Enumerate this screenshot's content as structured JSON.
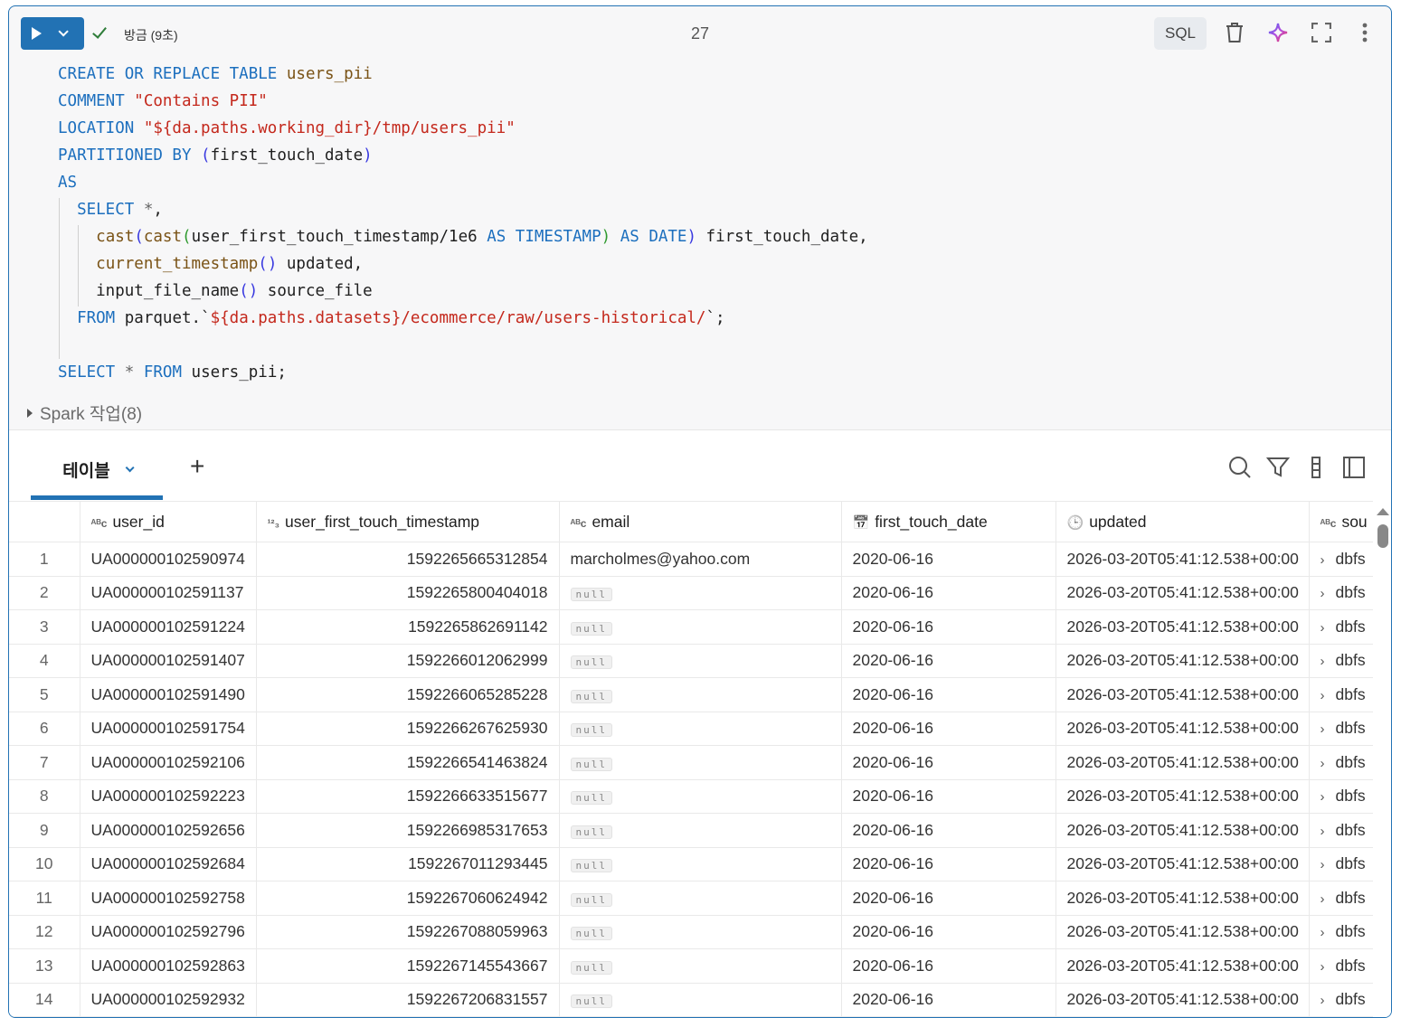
{
  "cell": {
    "status": "방금 (9초)",
    "cell_number": "27",
    "language": "SQL",
    "colors": {
      "accent": "#2272b4",
      "keyword": "#1c6fbe",
      "string": "#c4281c",
      "identifier": "#7a5316"
    },
    "code_lines": [
      [
        [
          "kw",
          "CREATE OR REPLACE TABLE "
        ],
        [
          "id",
          "users_pii"
        ]
      ],
      [
        [
          "kw",
          "COMMENT "
        ],
        [
          "str",
          "\"Contains PII\""
        ]
      ],
      [
        [
          "kw",
          "LOCATION "
        ],
        [
          "str",
          "\"${da.paths.working_dir}/tmp/users_pii\""
        ]
      ],
      [
        [
          "kw",
          "PARTITIONED BY "
        ],
        [
          "p1",
          "("
        ],
        [
          "pl",
          "first_touch_date"
        ],
        [
          "p1",
          ")"
        ]
      ],
      [
        [
          "kw",
          "AS"
        ]
      ],
      [
        [
          "pl",
          "  "
        ],
        [
          "kw",
          "SELECT "
        ],
        [
          "op",
          "*"
        ],
        [
          "pl",
          ","
        ]
      ],
      [
        [
          "pl",
          "    "
        ],
        [
          "fn",
          "cast"
        ],
        [
          "p1",
          "("
        ],
        [
          "fn",
          "cast"
        ],
        [
          "p2",
          "("
        ],
        [
          "pl",
          "user_first_touch_timestamp/1e6 "
        ],
        [
          "kw",
          "AS TIMESTAMP"
        ],
        [
          "p2",
          ")"
        ],
        [
          "kw",
          " AS DATE"
        ],
        [
          "p1",
          ")"
        ],
        [
          "pl",
          " first_touch_date,"
        ]
      ],
      [
        [
          "pl",
          "    "
        ],
        [
          "fn",
          "current_timestamp"
        ],
        [
          "p1",
          "()"
        ],
        [
          "pl",
          " updated,"
        ]
      ],
      [
        [
          "pl",
          "    input_file_name"
        ],
        [
          "p1",
          "()"
        ],
        [
          "pl",
          " source_file"
        ]
      ],
      [
        [
          "pl",
          "  "
        ],
        [
          "kw",
          "FROM "
        ],
        [
          "pl",
          "parquet.`"
        ],
        [
          "str",
          "${da.paths.datasets}/ecommerce/raw/users-historical/"
        ],
        [
          "pl",
          "`;"
        ]
      ],
      [
        [
          "pl",
          " "
        ]
      ],
      [
        [
          "kw",
          "SELECT "
        ],
        [
          "op",
          "* "
        ],
        [
          "kw",
          "FROM "
        ],
        [
          "pl",
          "users_pii;"
        ]
      ]
    ],
    "spark_jobs": "Spark 작업(8)"
  },
  "results": {
    "tab_label": "테이블",
    "columns": [
      {
        "type": "ABC",
        "name": "user_id"
      },
      {
        "type": "123",
        "name": "user_first_touch_timestamp"
      },
      {
        "type": "ABC",
        "name": "email"
      },
      {
        "type": "date",
        "name": "first_touch_date"
      },
      {
        "type": "timestamp",
        "name": "updated"
      },
      {
        "type": "ABC",
        "name": "sou"
      }
    ],
    "rows": [
      [
        "1",
        "UA000000102590974",
        "1592265665312854",
        "marcholmes@yahoo.com",
        "2020-06-16",
        "2026-03-20T05:41:12.538+00:00",
        "dbfs"
      ],
      [
        "2",
        "UA000000102591137",
        "1592265800404018",
        "null",
        "2020-06-16",
        "2026-03-20T05:41:12.538+00:00",
        "dbfs"
      ],
      [
        "3",
        "UA000000102591224",
        "1592265862691142",
        "null",
        "2020-06-16",
        "2026-03-20T05:41:12.538+00:00",
        "dbfs"
      ],
      [
        "4",
        "UA000000102591407",
        "1592266012062999",
        "null",
        "2020-06-16",
        "2026-03-20T05:41:12.538+00:00",
        "dbfs"
      ],
      [
        "5",
        "UA000000102591490",
        "1592266065285228",
        "null",
        "2020-06-16",
        "2026-03-20T05:41:12.538+00:00",
        "dbfs"
      ],
      [
        "6",
        "UA000000102591754",
        "1592266267625930",
        "null",
        "2020-06-16",
        "2026-03-20T05:41:12.538+00:00",
        "dbfs"
      ],
      [
        "7",
        "UA000000102592106",
        "1592266541463824",
        "null",
        "2020-06-16",
        "2026-03-20T05:41:12.538+00:00",
        "dbfs"
      ],
      [
        "8",
        "UA000000102592223",
        "1592266633515677",
        "null",
        "2020-06-16",
        "2026-03-20T05:41:12.538+00:00",
        "dbfs"
      ],
      [
        "9",
        "UA000000102592656",
        "1592266985317653",
        "null",
        "2020-06-16",
        "2026-03-20T05:41:12.538+00:00",
        "dbfs"
      ],
      [
        "10",
        "UA000000102592684",
        "1592267011293445",
        "null",
        "2020-06-16",
        "2026-03-20T05:41:12.538+00:00",
        "dbfs"
      ],
      [
        "11",
        "UA000000102592758",
        "1592267060624942",
        "null",
        "2020-06-16",
        "2026-03-20T05:41:12.538+00:00",
        "dbfs"
      ],
      [
        "12",
        "UA000000102592796",
        "1592267088059963",
        "null",
        "2020-06-16",
        "2026-03-20T05:41:12.538+00:00",
        "dbfs"
      ],
      [
        "13",
        "UA000000102592863",
        "1592267145543667",
        "null",
        "2020-06-16",
        "2026-03-20T05:41:12.538+00:00",
        "dbfs"
      ],
      [
        "14",
        "UA000000102592932",
        "1592267206831557",
        "null",
        "2020-06-16",
        "2026-03-20T05:41:12.538+00:00",
        "dbfs"
      ]
    ]
  }
}
